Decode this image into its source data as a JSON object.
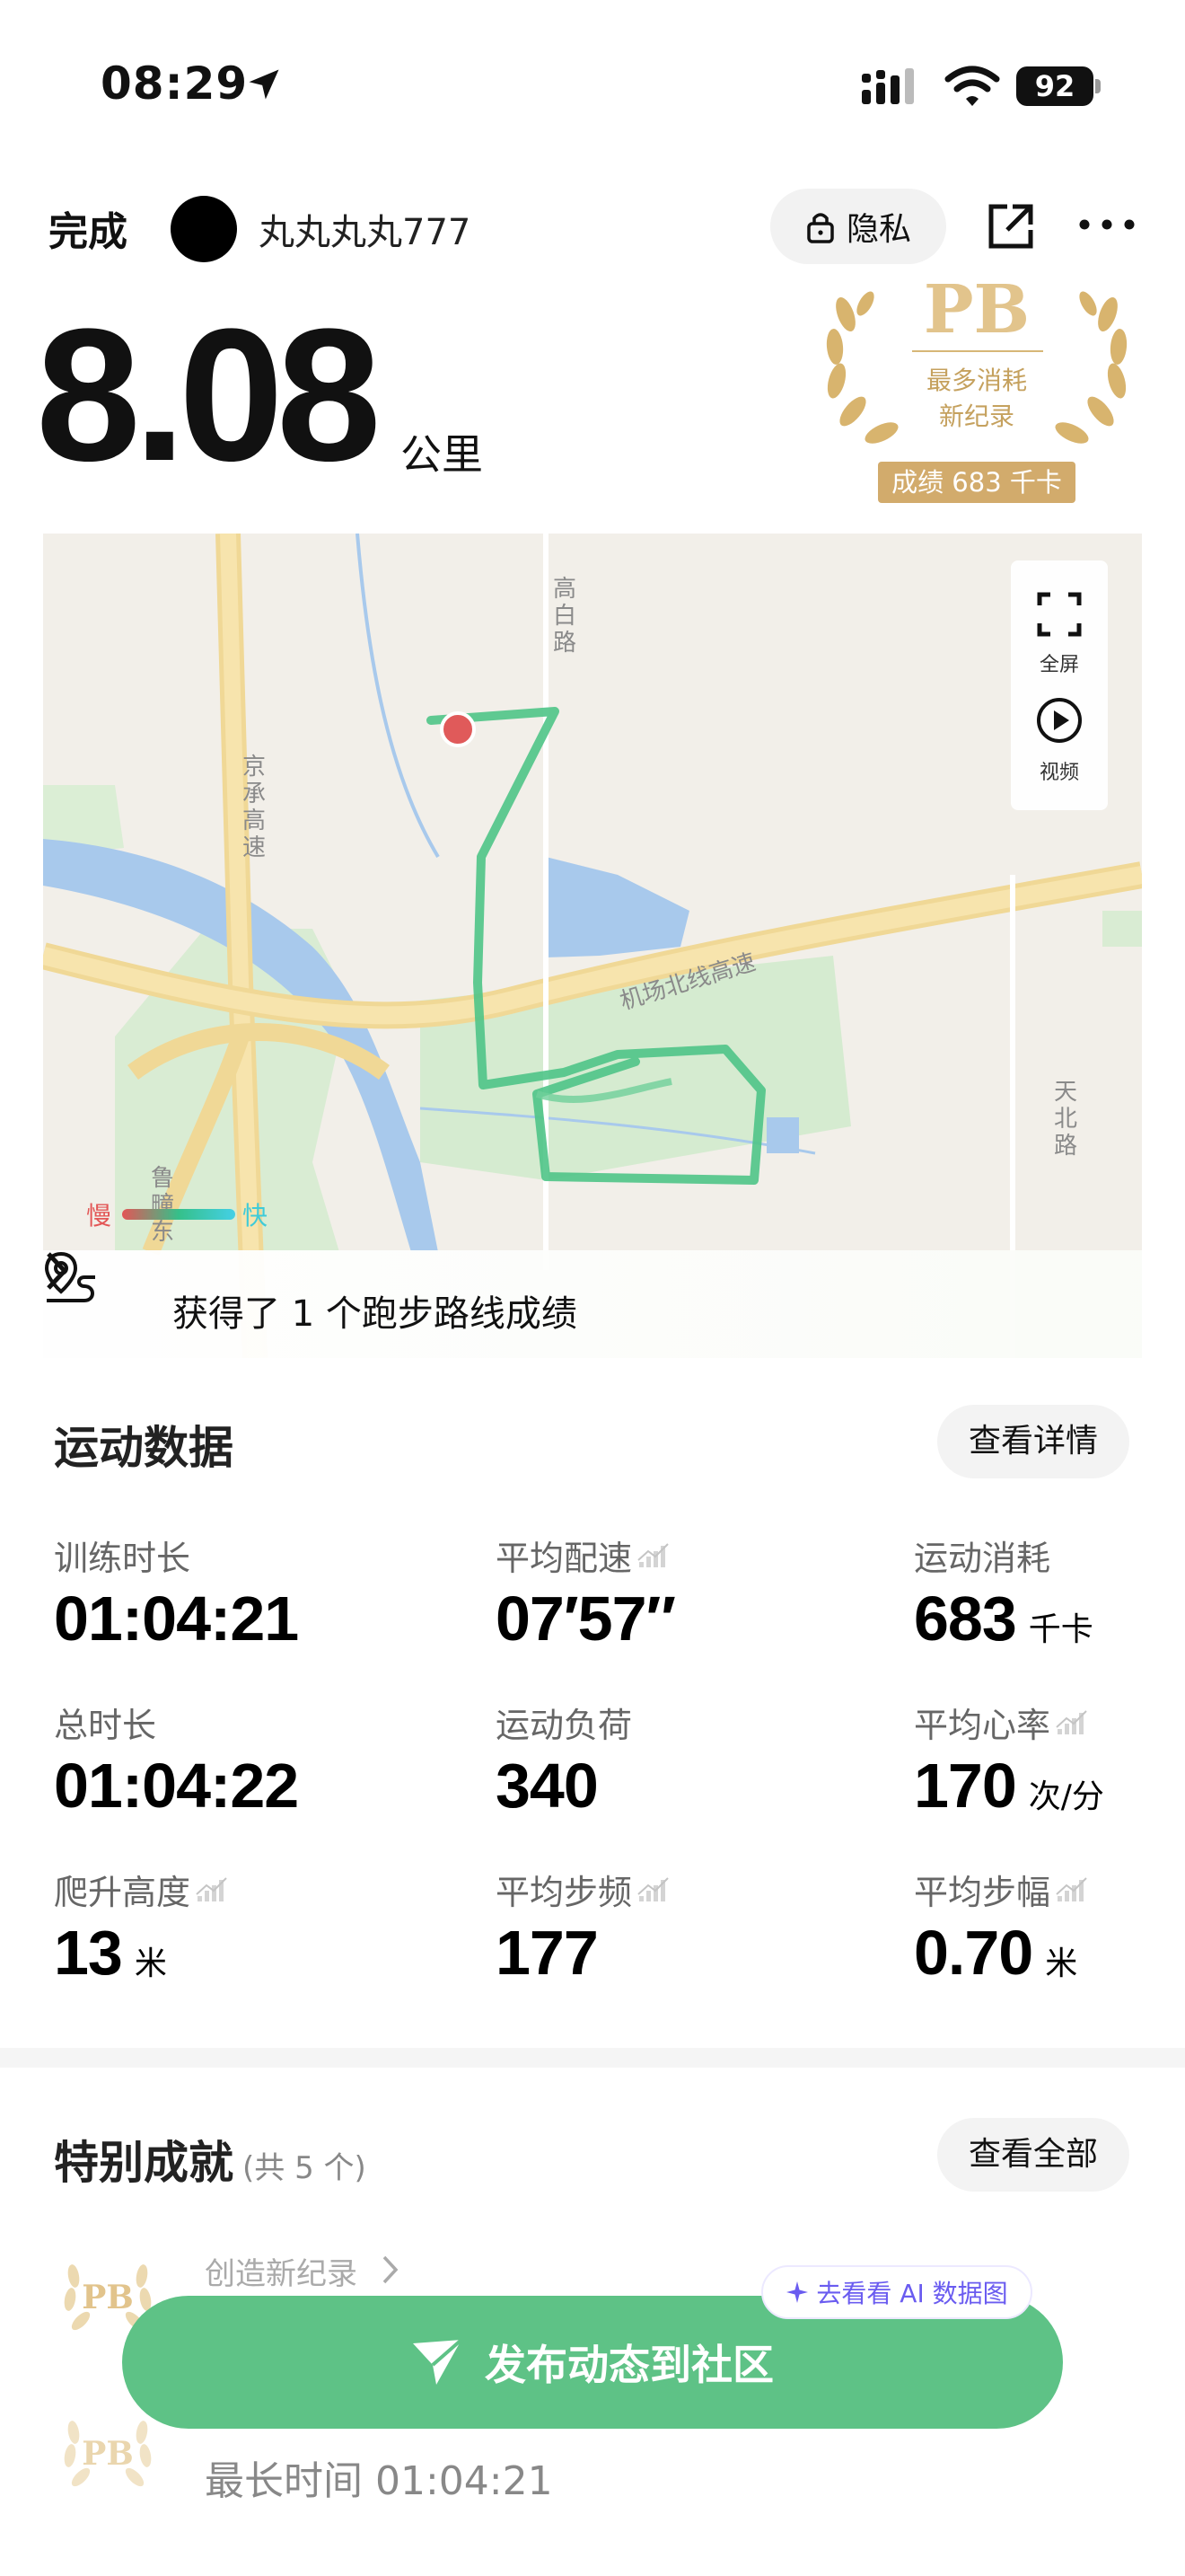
{
  "status_bar": {
    "time": "08:29",
    "battery": "92"
  },
  "nav": {
    "done_label": "完成",
    "username": "丸丸丸丸777",
    "privacy_label": "隐私"
  },
  "hero": {
    "distance": "8.08",
    "unit": "公里"
  },
  "pb_badge": {
    "title": "PB",
    "line1": "最多消耗",
    "line2": "新纪录",
    "score": "成绩 683 千卡"
  },
  "map": {
    "road_labels": [
      "高",
      "白",
      "路",
      "京",
      "承",
      "高",
      "速",
      "机场北线高速",
      "天",
      "北",
      "路",
      "鲁",
      "疃",
      "东"
    ],
    "fullscreen_label": "全屏",
    "video_label": "视频",
    "legend_slow": "慢",
    "legend_fast": "快",
    "route_achievement": "获得了 1 个跑步路线成绩",
    "route_color": "#4fc487"
  },
  "stats": {
    "title": "运动数据",
    "details_button": "查看详情",
    "items": [
      {
        "label": "训练时长",
        "value": "01:04:21",
        "unit": ""
      },
      {
        "label": "平均配速",
        "value": "07′57″",
        "unit": ""
      },
      {
        "label": "运动消耗",
        "value": "683",
        "unit": "千卡"
      },
      {
        "label": "总时长",
        "value": "01:04:22",
        "unit": ""
      },
      {
        "label": "运动负荷",
        "value": "340",
        "unit": ""
      },
      {
        "label": "平均心率",
        "value": "170",
        "unit": "次/分"
      },
      {
        "label": "爬升高度",
        "value": "13",
        "unit": "米"
      },
      {
        "label": "平均步频",
        "value": "177",
        "unit": ""
      },
      {
        "label": "平均步幅",
        "value": "0.70",
        "unit": "米"
      }
    ]
  },
  "achievements": {
    "title": "特别成就",
    "count": "(共 5 个)",
    "view_all_button": "查看全部",
    "item1_sub": "创造新纪录",
    "item2_main": "最长时间 01:04:21"
  },
  "fab": {
    "label": "发布动态到社区",
    "ai_label": "去看看 AI 数据图"
  },
  "colors": {
    "accent": "#5ec286",
    "gold": "#d2ab6c"
  }
}
